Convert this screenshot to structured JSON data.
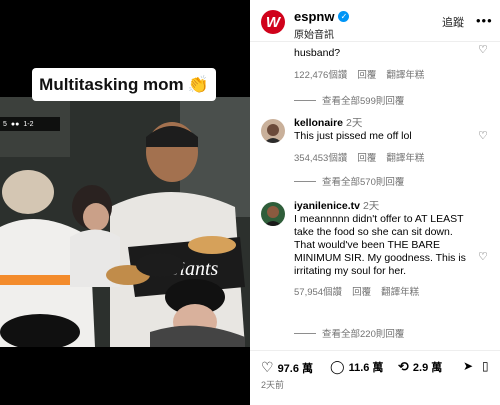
{
  "media": {
    "caption": "Multitasking mom",
    "caption_emoji": "👏",
    "scorebug": {
      "left": "5",
      "score": "1-2"
    },
    "jersey_text": "Giants"
  },
  "header": {
    "handle": "espnw",
    "logo_letter": "W",
    "subtitle": "原始音訊",
    "follow_label": "追蹤",
    "more_label": "•••"
  },
  "comments": [
    {
      "user": "",
      "time": "",
      "text": "husband?",
      "likes": "122,476個讚",
      "reply": "回覆",
      "translate": "翻譯年糕",
      "view_replies": "查看全部599則回覆"
    },
    {
      "user": "kellonaire",
      "time": "2天",
      "text": "This just pissed me off lol",
      "likes": "354,453個讚",
      "reply": "回覆",
      "translate": "翻譯年糕",
      "view_replies": "查看全部570則回覆"
    },
    {
      "user": "iyanilenice.tv",
      "time": "2天",
      "text": "I meannnnn didn't offer to AT LEAST take the food so she can sit down. That would've been THE BARE MINIMUM SIR. My goodness. This is irritating my soul for her.",
      "likes": "57,954個讚",
      "reply": "回覆",
      "translate": "翻譯年糕",
      "view_replies": "查看全部220則回覆"
    }
  ],
  "actions": {
    "likes": "97.6 萬",
    "comments": "11.6 萬",
    "shares": "2.9 萬"
  },
  "posted": "2天前",
  "colors": {
    "brand": "#d0021b",
    "verified": "#0095f6",
    "muted": "#737373"
  }
}
